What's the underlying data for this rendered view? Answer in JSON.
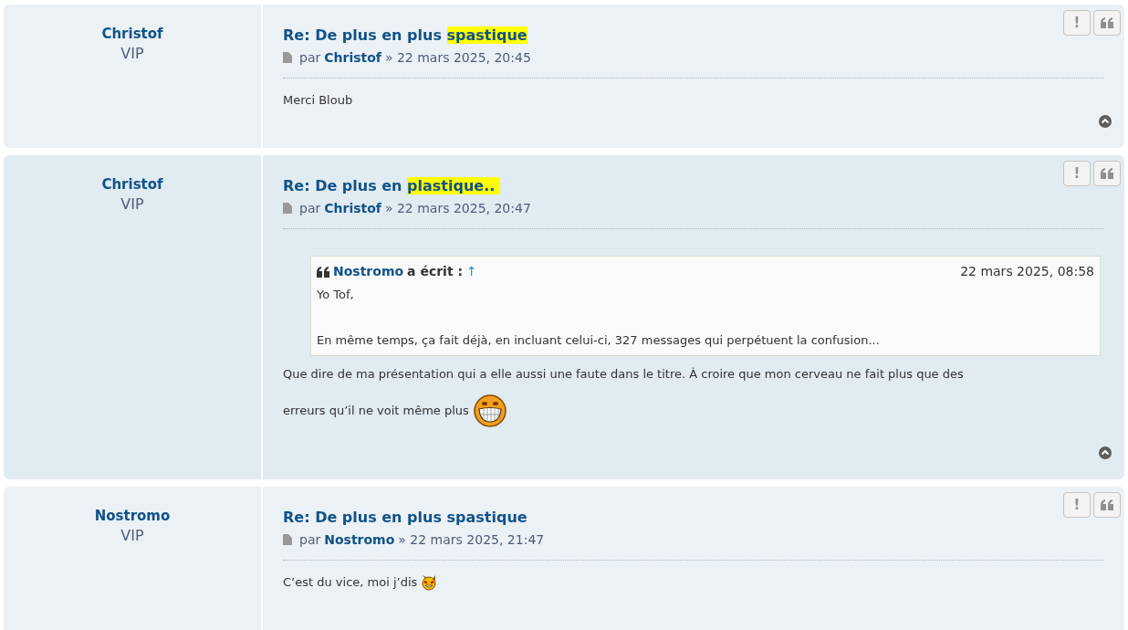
{
  "posts": [
    {
      "author": "Christof",
      "rank": "VIP",
      "title_parts": [
        {
          "text": "Re: De plus en plus ",
          "highlighted": false
        },
        {
          "text": "spastique",
          "highlighted": true
        }
      ],
      "by": "par",
      "by_author": "Christof",
      "date": "» 22 mars 2025, 20:45",
      "report": "!",
      "body": [
        {
          "kind": "text",
          "pieces": [
            {
              "kind": "text",
              "text": "Merci Bloub"
            }
          ]
        }
      ]
    },
    {
      "author": "Christof",
      "rank": "VIP",
      "title_parts": [
        {
          "text": "Re: De plus en ",
          "highlighted": false
        },
        {
          "text": "plastique.. ",
          "highlighted": true
        }
      ],
      "by": "par",
      "by_author": "Christof",
      "date": "» 22 mars 2025, 20:47",
      "report": "!",
      "body": [
        {
          "kind": "quote",
          "author": "Nostromo",
          "wrote": "a écrit :",
          "arrow": "↑",
          "date": "22 mars 2025, 08:58",
          "paragraphs": [
            "Yo Tof,",
            "En même temps, ça fait déjà, en incluant celui-ci, 327 messages qui perpétuent la confusion..."
          ]
        },
        {
          "kind": "text",
          "pieces": [
            {
              "kind": "text",
              "text": "Que dire de ma présentation qui a elle aussi une faute dans le titre. À croire que mon cerveau ne fait plus que des"
            }
          ]
        },
        {
          "kind": "text",
          "pieces": [
            {
              "kind": "text",
              "text": "erreurs qu’il ne voit même plus"
            },
            {
              "kind": "grin"
            }
          ]
        }
      ]
    },
    {
      "author": "Nostromo",
      "rank": "VIP",
      "title_parts": [
        {
          "text": "Re: De plus en plus spastique",
          "highlighted": false
        }
      ],
      "by": "par",
      "by_author": "Nostromo",
      "date": "» 22 mars 2025, 21:47",
      "report": "!",
      "body": [
        {
          "kind": "text",
          "pieces": [
            {
              "kind": "text",
              "text": "C’est du vice, moi j’dis"
            },
            {
              "kind": "devil"
            }
          ]
        }
      ]
    }
  ]
}
